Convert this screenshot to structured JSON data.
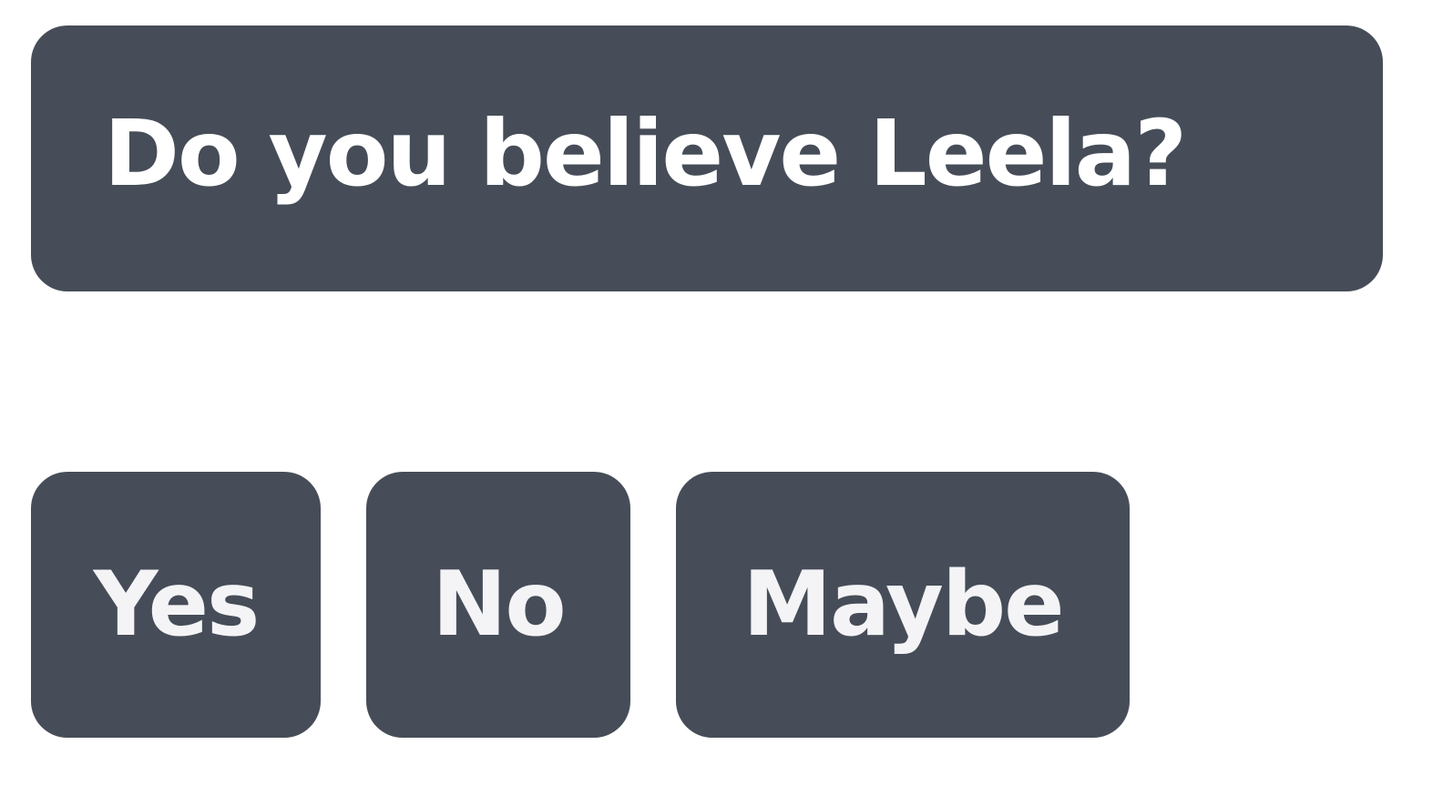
{
  "question": {
    "text": "Do you believe Leela?"
  },
  "choices": [
    {
      "label": "Yes"
    },
    {
      "label": "No"
    },
    {
      "label": "Maybe"
    }
  ],
  "colors": {
    "panel_background": "#464d58",
    "question_text": "#ffffff",
    "choice_text": "#f4f4f7",
    "page_background": "#ffffff"
  }
}
